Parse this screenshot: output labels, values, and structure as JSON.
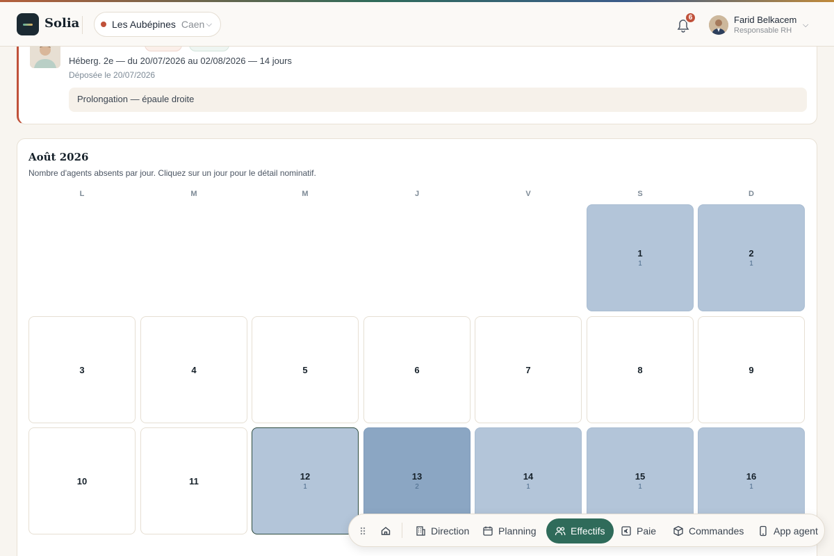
{
  "app": {
    "name": "Solia"
  },
  "site": {
    "name": "Les Aubépines",
    "city": "Caen"
  },
  "notifications": {
    "count": "6"
  },
  "user": {
    "name": "Farid Belkacem",
    "role": "Responsable RH"
  },
  "request": {
    "details": "Héberg. 2e — du 20/07/2026 au 02/08/2026 — 14 jours",
    "submitted": "Déposée le 20/07/2026",
    "note": "Prolongation — épaule droite"
  },
  "calendar": {
    "title": "Août 2026",
    "subtitle": "Nombre d'agents absents par jour. Cliquez sur un jour pour le détail nominatif.",
    "weekdays": [
      "L",
      "M",
      "M",
      "J",
      "V",
      "S",
      "D"
    ],
    "days": [
      {
        "day": "1",
        "count": "1"
      },
      {
        "day": "2",
        "count": "1"
      },
      {
        "day": "3",
        "count": ""
      },
      {
        "day": "4",
        "count": ""
      },
      {
        "day": "5",
        "count": ""
      },
      {
        "day": "6",
        "count": ""
      },
      {
        "day": "7",
        "count": ""
      },
      {
        "day": "8",
        "count": ""
      },
      {
        "day": "9",
        "count": ""
      },
      {
        "day": "10",
        "count": ""
      },
      {
        "day": "11",
        "count": ""
      },
      {
        "day": "12",
        "count": "1"
      },
      {
        "day": "13",
        "count": "2"
      },
      {
        "day": "14",
        "count": "1"
      },
      {
        "day": "15",
        "count": "1"
      },
      {
        "day": "16",
        "count": "1"
      }
    ],
    "selected_day": "12"
  },
  "bottom_nav": {
    "items": [
      {
        "label": "Direction",
        "icon": "building-icon"
      },
      {
        "label": "Planning",
        "icon": "calendar-icon"
      },
      {
        "label": "Effectifs",
        "icon": "users-icon",
        "active": true
      },
      {
        "label": "Paie",
        "icon": "euro-icon"
      },
      {
        "label": "Commandes",
        "icon": "box-icon"
      },
      {
        "label": "App agent",
        "icon": "phone-icon"
      }
    ]
  },
  "colors": {
    "accent": "#2f6b5a",
    "alert": "#c0513a",
    "heat_1": "#b3c5d9",
    "heat_2": "#8ba6c3"
  }
}
